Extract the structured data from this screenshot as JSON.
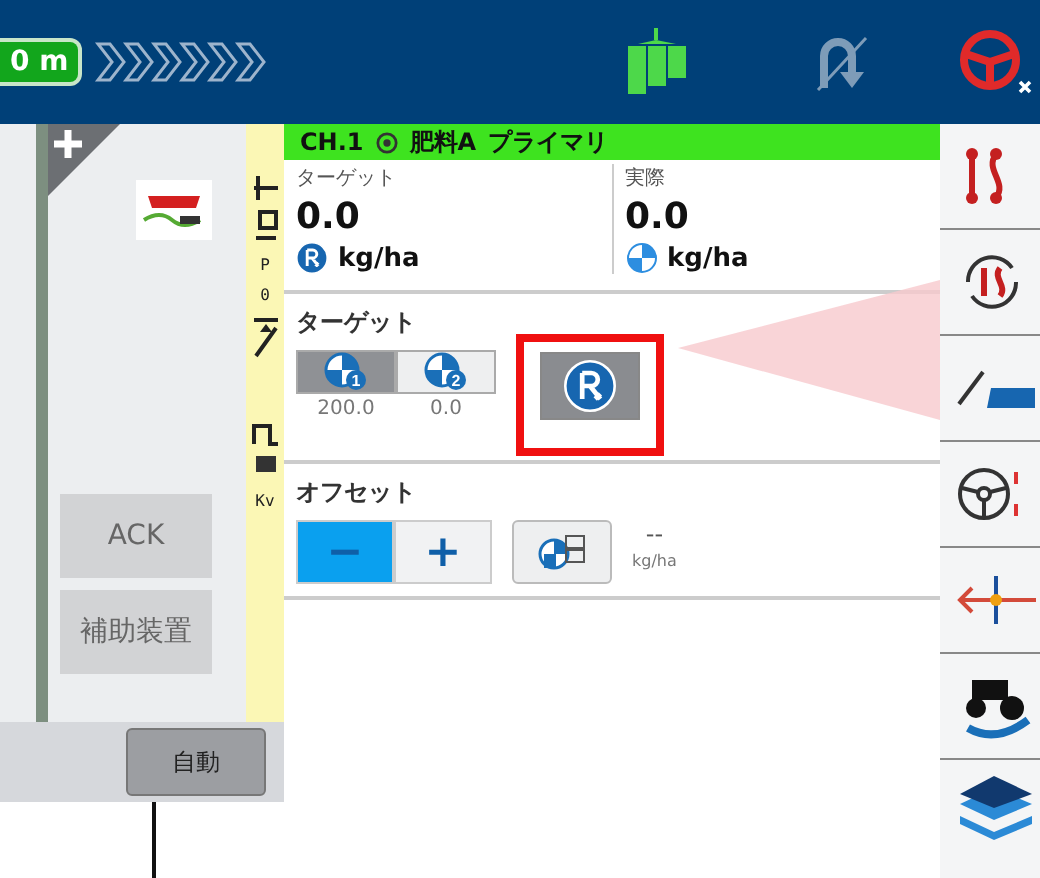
{
  "top_bar": {
    "distance": "0 m"
  },
  "left_panel": {
    "buttons": [
      {
        "label": "ACK"
      },
      {
        "label": "補助装置"
      }
    ],
    "mode_button": "自動"
  },
  "side_strip": {
    "labels": [
      "P",
      "0",
      "Kv"
    ]
  },
  "channel": {
    "name": "CH.1",
    "product": "肥料A",
    "role": "プライマリ"
  },
  "readouts": [
    {
      "label": "ターゲット",
      "value": "0.0",
      "unit": "kg/ha",
      "kind": "rx"
    },
    {
      "label": "実際",
      "value": "0.0",
      "unit": "kg/ha",
      "kind": "actual"
    }
  ],
  "target": {
    "title": "ターゲット",
    "presets": [
      {
        "number": "1",
        "value": "200.0",
        "selected": true
      },
      {
        "number": "2",
        "value": "0.0",
        "selected": false
      }
    ],
    "rx_selected": true,
    "highlighted": true
  },
  "offset": {
    "title": "オフセット",
    "buttons": [
      {
        "label": "−",
        "selected": true
      },
      {
        "label": "+",
        "selected": false
      }
    ],
    "value": "--",
    "unit": "kg/ha"
  }
}
